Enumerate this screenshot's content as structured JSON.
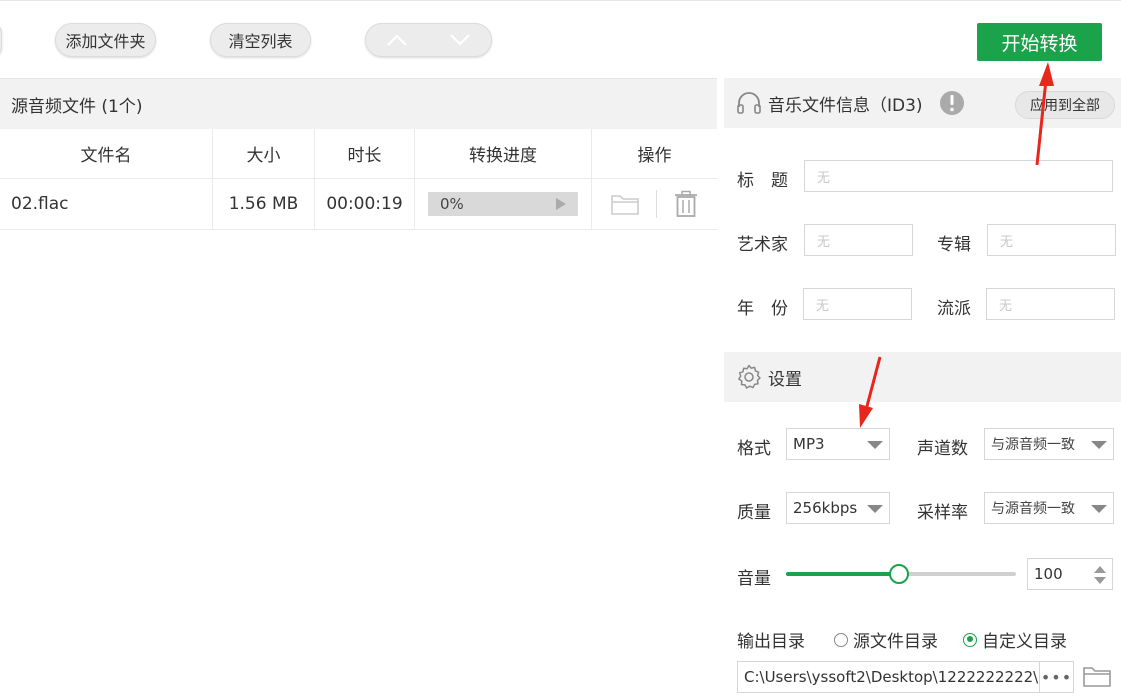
{
  "toolbar": {
    "add_folder_label": "添加文件夹",
    "clear_list_label": "清空列表",
    "start_label": "开始转换"
  },
  "file_list": {
    "header": "源音频文件 (1个)",
    "columns": [
      "文件名",
      "大小",
      "时长",
      "转换进度",
      "操作"
    ],
    "rows": [
      {
        "name": "02.flac",
        "size": "1.56 MB",
        "duration": "00:00:19",
        "progress": "0%"
      }
    ]
  },
  "id3": {
    "title": "音乐文件信息（ID3)",
    "apply_all_label": "应用到全部",
    "title_label": "标　题",
    "artist_label": "艺术家",
    "album_label": "专辑",
    "year_label": "年　份",
    "genre_label": "流派",
    "empty_placeholder": "无"
  },
  "settings": {
    "title": "设置",
    "format_label": "格式",
    "format_value": "MP3",
    "channels_label": "声道数",
    "channels_value": "与源音频一致",
    "quality_label": "质量",
    "quality_value": "256kbps",
    "samplerate_label": "采样率",
    "samplerate_value": "与源音频一致",
    "volume_label": "音量",
    "volume_value": "100",
    "volume_slider_fraction": 0.49,
    "output_label": "输出目录",
    "output_opt_source": "源文件目录",
    "output_opt_custom": "自定义目录",
    "output_selected": "custom",
    "output_path": "C:\\Users\\yssoft2\\Desktop\\1222222222\\"
  },
  "colors": {
    "accent": "#1aa34a",
    "annotation": "#e8261c"
  }
}
